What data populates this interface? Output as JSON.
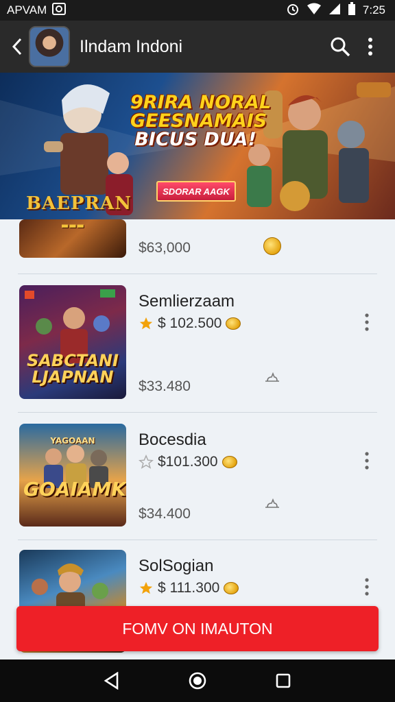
{
  "status_bar": {
    "carrier": "APVAM",
    "time": "7:25"
  },
  "app_bar": {
    "title": "Ilndam Indoni",
    "back_icon": "back-arrow-icon",
    "search_icon": "search-icon",
    "more_icon": "more-vert-icon"
  },
  "banner": {
    "headline_lines": [
      "9RIRA NORAL",
      "GEESNAMAIS",
      "BICUS DUA!"
    ],
    "cta_label": "SDORAR AAGK",
    "logo_text": "BAEPRAN"
  },
  "items": [
    {
      "name": "",
      "price_main": "$63,000",
      "thumb_text": ""
    },
    {
      "name": "Semlierzaam",
      "rating_price": "$ 102.500",
      "price_main": "$33.480",
      "star_filled": true,
      "thumb_text": "SABCTANI LJAPNAN"
    },
    {
      "name": "Bocesdia",
      "rating_price": "$101.300",
      "price_main": "$34.400",
      "star_filled": false,
      "thumb_text": "GOAIAMK",
      "thumb_small": "YAGOAAN"
    },
    {
      "name": "SolSogian",
      "rating_price": "$ 111.300",
      "star_filled": true,
      "thumb_text": ""
    }
  ],
  "cta_button": {
    "label": "FOMV ON IMAUTON"
  },
  "colors": {
    "accent_red": "#ee2027",
    "coin_gold": "#e5a612",
    "star_gold": "#f2a20a"
  }
}
